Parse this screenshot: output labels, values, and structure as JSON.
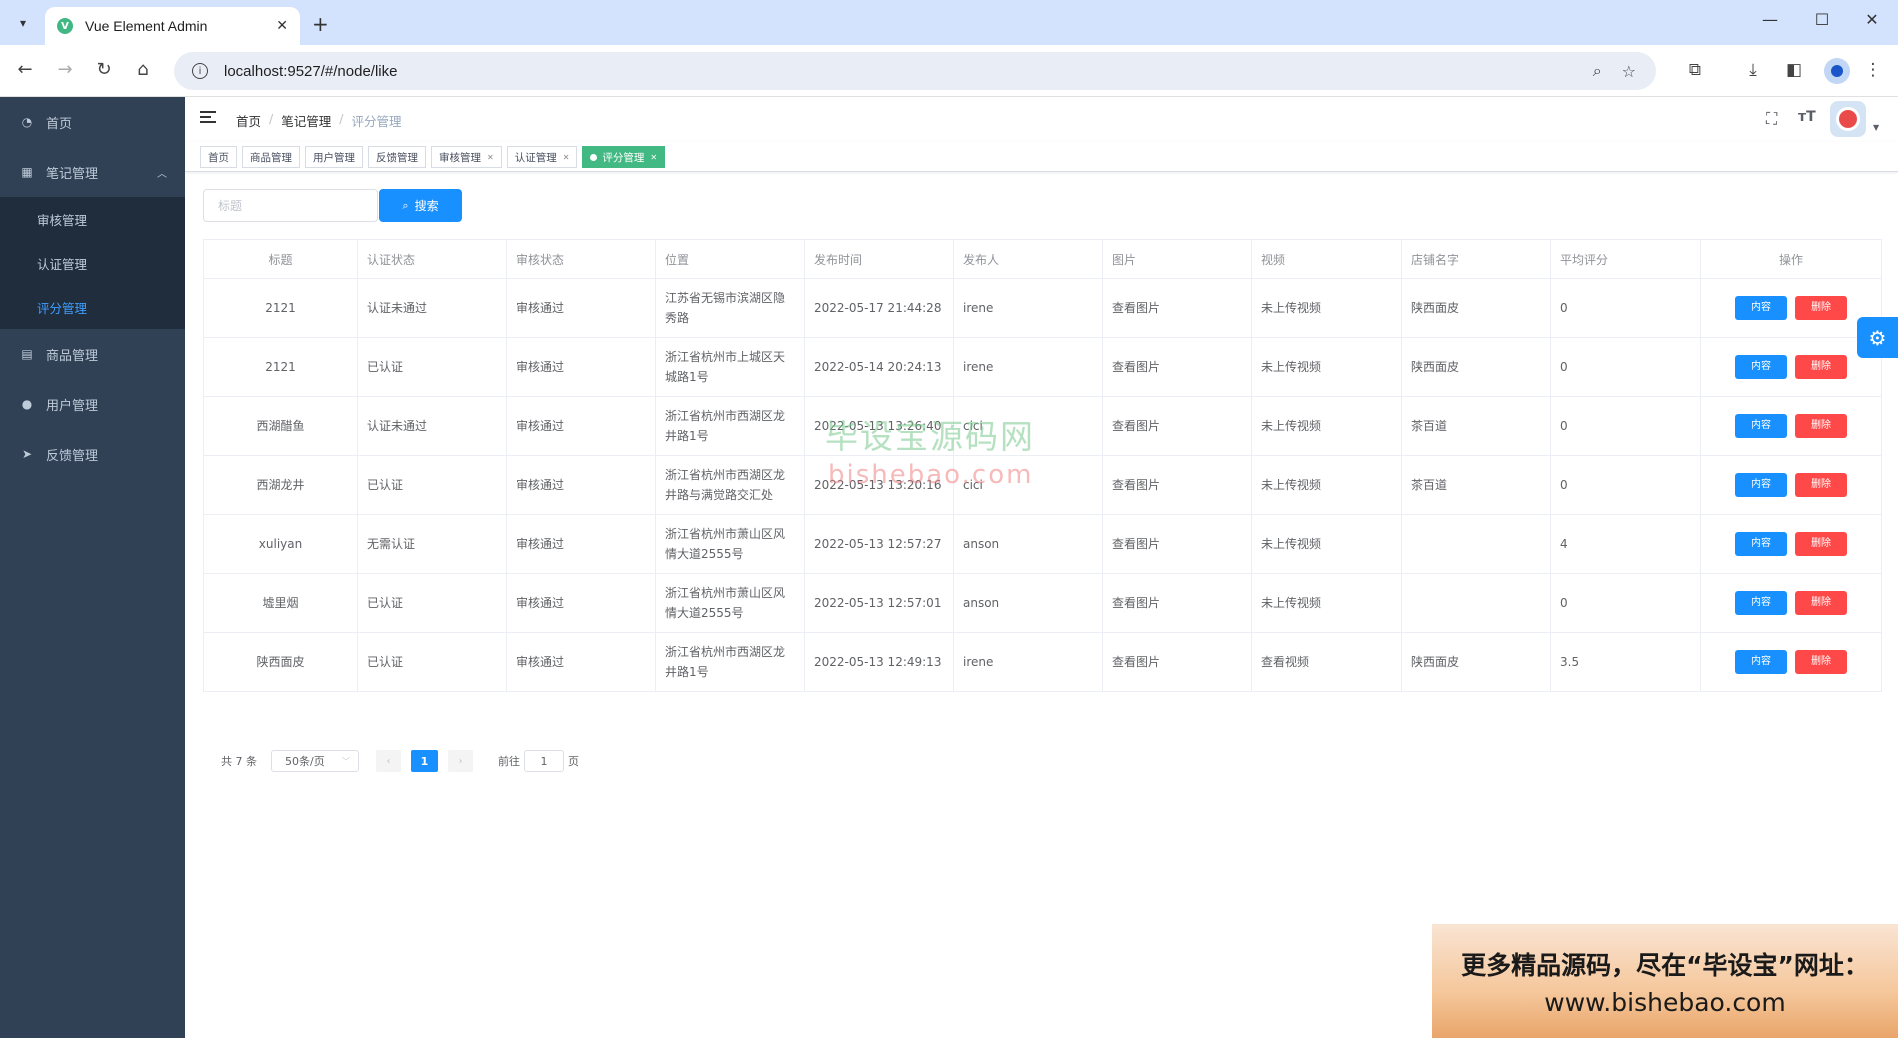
{
  "browser": {
    "tab_title": "Vue Element Admin",
    "favicon_letter": "V",
    "url": "localhost:9527/#/node/like"
  },
  "sidebar": {
    "items": [
      {
        "label": "首页",
        "icon": "dashboard-icon"
      },
      {
        "label": "笔记管理",
        "icon": "table-icon",
        "expanded": true,
        "children": [
          {
            "label": "审核管理",
            "active": false
          },
          {
            "label": "认证管理",
            "active": false
          },
          {
            "label": "评分管理",
            "active": true
          }
        ]
      },
      {
        "label": "商品管理",
        "icon": "document-icon"
      },
      {
        "label": "用户管理",
        "icon": "user-icon"
      },
      {
        "label": "反馈管理",
        "icon": "send-icon"
      }
    ]
  },
  "breadcrumb": [
    "首页",
    "笔记管理",
    "评分管理"
  ],
  "tags": [
    {
      "label": "首页",
      "closable": false
    },
    {
      "label": "商品管理",
      "closable": false
    },
    {
      "label": "用户管理",
      "closable": false
    },
    {
      "label": "反馈管理",
      "closable": false
    },
    {
      "label": "审核管理",
      "closable": true
    },
    {
      "label": "认证管理",
      "closable": true
    },
    {
      "label": "评分管理",
      "closable": true,
      "active": true
    }
  ],
  "search": {
    "placeholder": "标题",
    "button_label": "搜索"
  },
  "table": {
    "headers": [
      "标题",
      "认证状态",
      "审核状态",
      "位置",
      "发布时间",
      "发布人",
      "图片",
      "视频",
      "店铺名字",
      "平均评分",
      "操作"
    ],
    "rows": [
      [
        "2121",
        "认证未通过",
        "审核通过",
        "江苏省无锡市滨湖区隐秀路",
        "2022-05-17 21:44:28",
        "irene",
        "查看图片",
        "未上传视频",
        "陕西面皮",
        "0"
      ],
      [
        "2121",
        "已认证",
        "审核通过",
        "浙江省杭州市上城区天城路1号",
        "2022-05-14 20:24:13",
        "irene",
        "查看图片",
        "未上传视频",
        "陕西面皮",
        "0"
      ],
      [
        "西湖醋鱼",
        "认证未通过",
        "审核通过",
        "浙江省杭州市西湖区龙井路1号",
        "2022-05-13 13:26:40",
        "cici",
        "查看图片",
        "未上传视频",
        "茶百道",
        "0"
      ],
      [
        "西湖龙井",
        "已认证",
        "审核通过",
        "浙江省杭州市西湖区龙井路与满觉路交汇处",
        "2022-05-13 13:20:16",
        "cici",
        "查看图片",
        "未上传视频",
        "茶百道",
        "0"
      ],
      [
        "xuliyan",
        "无需认证",
        "审核通过",
        "浙江省杭州市萧山区风情大道2555号",
        "2022-05-13 12:57:27",
        "anson",
        "查看图片",
        "未上传视频",
        "",
        "4"
      ],
      [
        "墟里烟",
        "已认证",
        "审核通过",
        "浙江省杭州市萧山区风情大道2555号",
        "2022-05-13 12:57:01",
        "anson",
        "查看图片",
        "未上传视频",
        "",
        "0"
      ],
      [
        "陕西面皮",
        "已认证",
        "审核通过",
        "浙江省杭州市西湖区龙井路1号",
        "2022-05-13 12:49:13",
        "irene",
        "查看图片",
        "查看视频",
        "陕西面皮",
        "3.5"
      ]
    ],
    "action_content": "内容",
    "action_delete": "删除"
  },
  "pagination": {
    "total": "共 7 条",
    "page_size": "50条/页",
    "current_page": "1",
    "goto_prefix": "前往",
    "goto_value": "1",
    "goto_suffix": "页"
  },
  "watermark": {
    "line1": "毕设宝源码网",
    "line2": "bishebao.com"
  },
  "ad": {
    "line1": "更多精品源码，尽在“毕设宝”网址：",
    "line2": "www.bishebao.com"
  },
  "colors": {
    "primary": "#1890ff",
    "danger": "#ff4949",
    "sidebar_bg": "#304156",
    "active_tag": "#42b983"
  }
}
